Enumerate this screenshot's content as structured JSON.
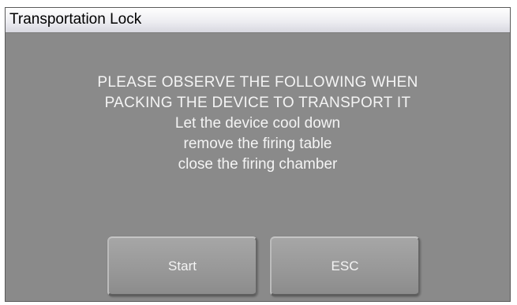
{
  "dialog": {
    "title": "Transportation Lock",
    "message_lines": [
      "PLEASE OBSERVE THE FOLLOWING WHEN",
      "PACKING THE DEVICE TO TRANSPORT IT",
      "Let the device cool down",
      "remove the firing table",
      "close the firing chamber"
    ],
    "buttons": {
      "start_label": "Start",
      "esc_label": "ESC"
    }
  },
  "colors": {
    "background": "#8a8a8a",
    "titlebar": "#eeeef2",
    "text_light": "#f4f4f4",
    "button_face": "#9a9a9a"
  }
}
